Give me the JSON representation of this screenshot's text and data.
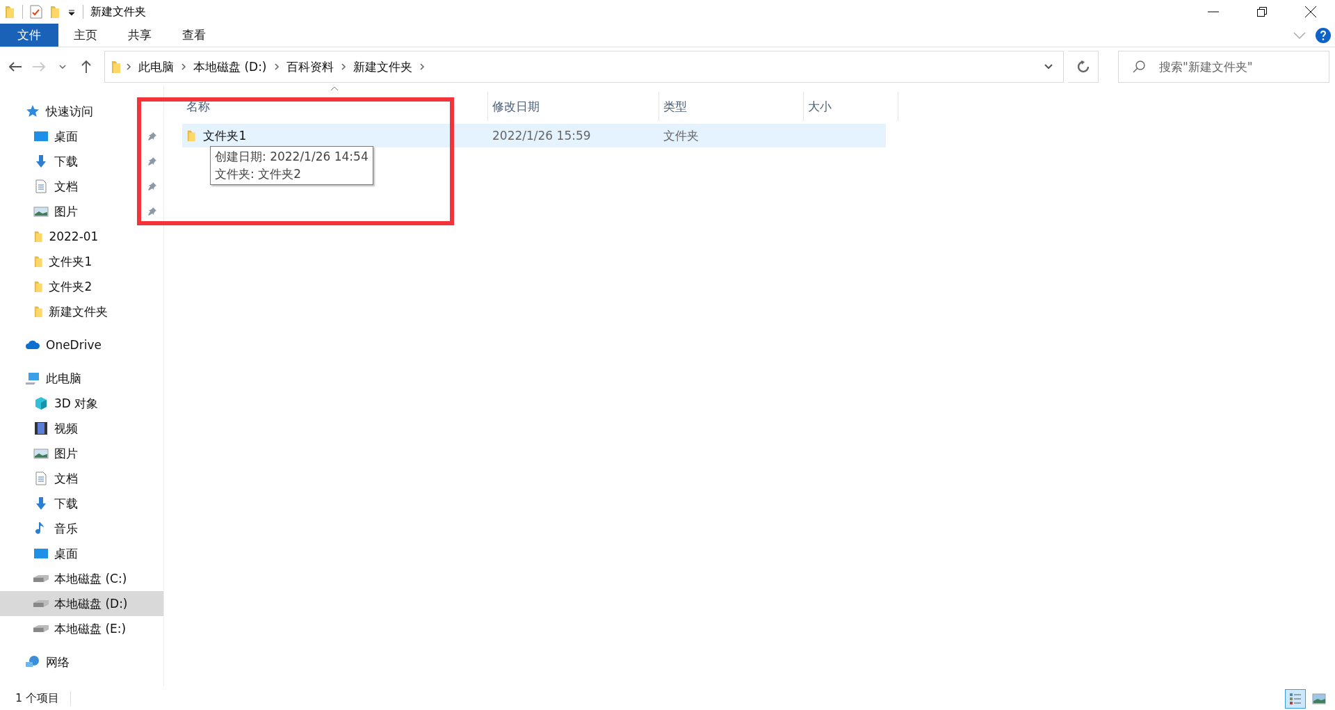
{
  "window": {
    "title": "新建文件夹"
  },
  "ribbon_tabs": [
    {
      "label": "文件",
      "selected": true
    },
    {
      "label": "主页",
      "selected": false
    },
    {
      "label": "共享",
      "selected": false
    },
    {
      "label": "查看",
      "selected": false
    }
  ],
  "address_bar": {
    "path": [
      "此电脑",
      "本地磁盘 (D:)",
      "百科资料",
      "新建文件夹"
    ]
  },
  "search": {
    "placeholder": "搜索\"新建文件夹\""
  },
  "sidebar": {
    "items": [
      {
        "label": "快速访问",
        "kind": "star",
        "selected": false,
        "children": [
          {
            "label": "桌面",
            "kind": "desktop",
            "pinned": true,
            "selected": false
          },
          {
            "label": "下载",
            "kind": "download",
            "pinned": true,
            "selected": false
          },
          {
            "label": "文档",
            "kind": "document",
            "pinned": true,
            "selected": false
          },
          {
            "label": "图片",
            "kind": "picture",
            "pinned": true,
            "selected": false
          },
          {
            "label": "2022-01",
            "kind": "folder",
            "pinned": false,
            "selected": false
          },
          {
            "label": "文件夹1",
            "kind": "folder",
            "pinned": false,
            "selected": false
          },
          {
            "label": "文件夹2",
            "kind": "folder",
            "pinned": false,
            "selected": false
          },
          {
            "label": "新建文件夹",
            "kind": "folder",
            "pinned": false,
            "selected": false
          }
        ]
      },
      {
        "label": "OneDrive",
        "kind": "cloud",
        "selected": false
      },
      {
        "label": "此电脑",
        "kind": "computer",
        "selected": false,
        "children": [
          {
            "label": "3D 对象",
            "kind": "cube",
            "selected": false
          },
          {
            "label": "视频",
            "kind": "video",
            "selected": false
          },
          {
            "label": "图片",
            "kind": "picture",
            "selected": false
          },
          {
            "label": "文档",
            "kind": "document",
            "selected": false
          },
          {
            "label": "下载",
            "kind": "download",
            "selected": false
          },
          {
            "label": "音乐",
            "kind": "music",
            "selected": false
          },
          {
            "label": "桌面",
            "kind": "desktop",
            "selected": false
          },
          {
            "label": "本地磁盘 (C:)",
            "kind": "drive",
            "selected": false
          },
          {
            "label": "本地磁盘 (D:)",
            "kind": "drive",
            "selected": true
          },
          {
            "label": "本地磁盘 (E:)",
            "kind": "drive",
            "selected": false
          }
        ]
      },
      {
        "label": "网络",
        "kind": "network",
        "selected": false
      }
    ]
  },
  "table": {
    "columns": [
      "名称",
      "修改日期",
      "类型",
      "大小"
    ],
    "rows": [
      {
        "name": "文件夹1",
        "modified": "2022/1/26 15:59",
        "type": "文件夹",
        "selected": true
      }
    ]
  },
  "tooltip": {
    "lines": [
      "创建日期: 2022/1/26 14:54",
      "文件夹: 文件夹2"
    ]
  },
  "status_bar": {
    "count": "1 个项目",
    "views": [
      {
        "kind": "details",
        "selected": true
      },
      {
        "kind": "large-icons",
        "selected": false
      }
    ]
  }
}
